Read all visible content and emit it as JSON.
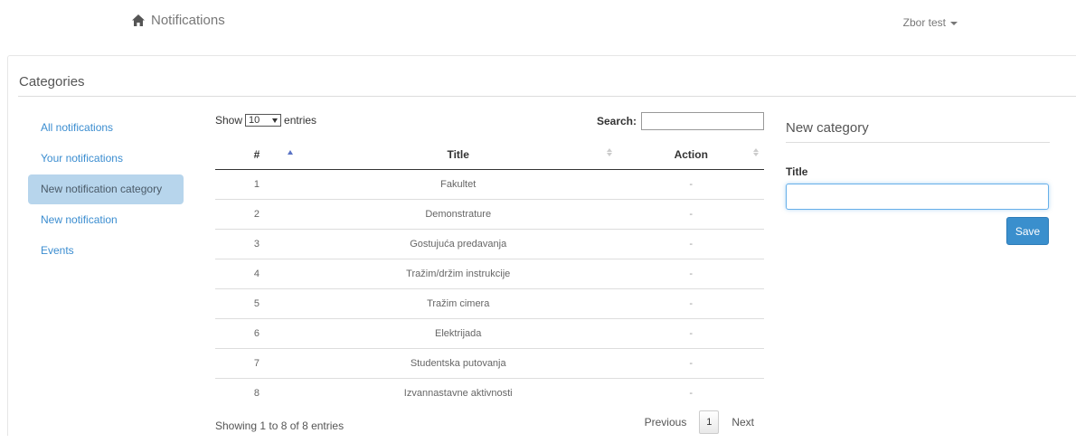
{
  "header": {
    "brand_icon": "home-icon",
    "title": "Notifications",
    "user_menu": "Zbor test"
  },
  "panel": {
    "title": "Categories"
  },
  "sidebar": {
    "items": [
      {
        "label": "All notifications",
        "active": false
      },
      {
        "label": "Your notifications",
        "active": false
      },
      {
        "label": "New notification category",
        "active": true
      },
      {
        "label": "New notification",
        "active": false
      },
      {
        "label": "Events",
        "active": false
      }
    ]
  },
  "table": {
    "show_label": "Show",
    "entries_value": "10",
    "entries_label": "entries",
    "search_label": "Search:",
    "search_value": "",
    "columns": [
      "#",
      "Title",
      "Action"
    ],
    "rows": [
      {
        "num": "1",
        "title": "Fakultet",
        "action": "-"
      },
      {
        "num": "2",
        "title": "Demonstrature",
        "action": "-"
      },
      {
        "num": "3",
        "title": "Gostujuća predavanja",
        "action": "-"
      },
      {
        "num": "4",
        "title": "Tražim/držim instrukcije",
        "action": "-"
      },
      {
        "num": "5",
        "title": "Tražim cimera",
        "action": "-"
      },
      {
        "num": "6",
        "title": "Elektrijada",
        "action": "-"
      },
      {
        "num": "7",
        "title": "Studentska putovanja",
        "action": "-"
      },
      {
        "num": "8",
        "title": "Izvannastavne aktivnosti",
        "action": "-"
      }
    ],
    "info": "Showing 1 to 8 of 8 entries",
    "previous": "Previous",
    "current_page": "1",
    "next": "Next"
  },
  "form": {
    "title": "New category",
    "field_label": "Title",
    "field_value": "",
    "save_label": "Save"
  },
  "colors": {
    "link": "#3b8dd0",
    "active_nav_bg": "#b7d5ec",
    "save_button": "#3a8fcd",
    "sort_active": "#5a73c5"
  }
}
